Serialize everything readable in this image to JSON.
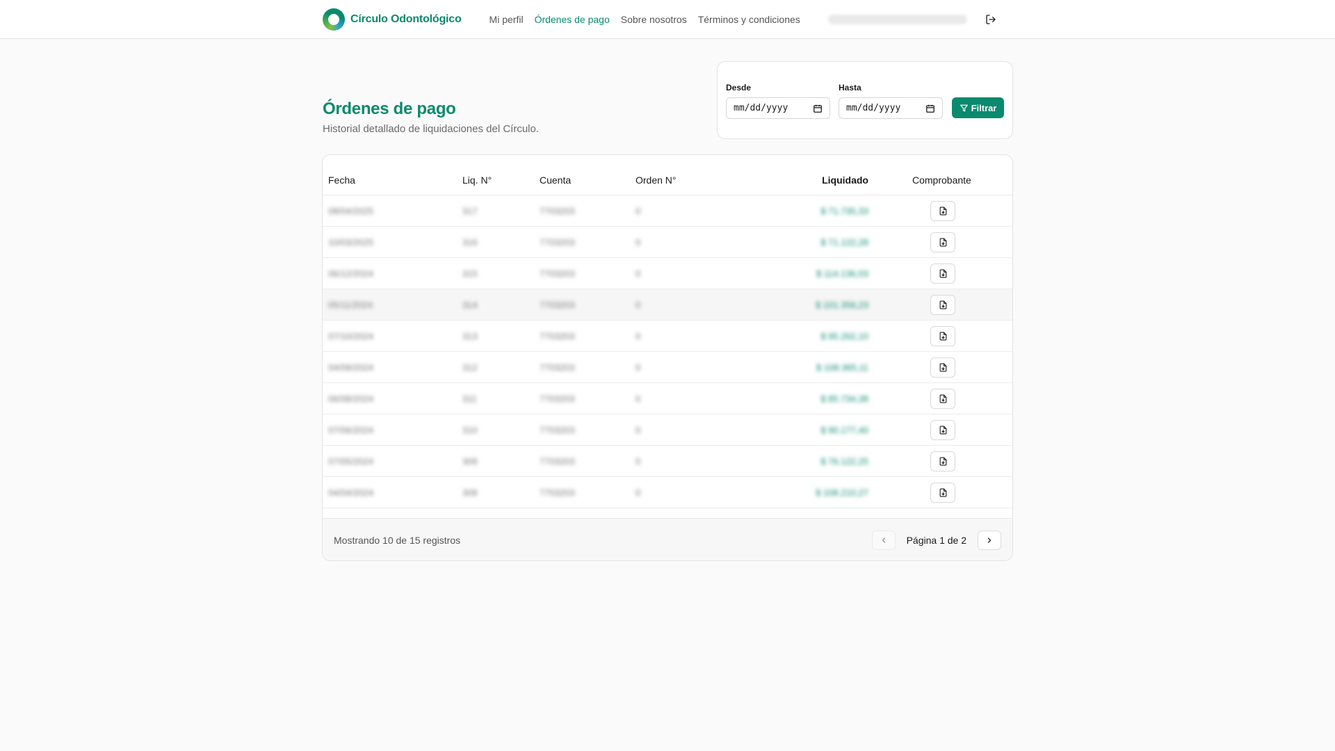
{
  "header": {
    "brand": "Círculo Odontológico",
    "nav": [
      {
        "label": "Mi perfil",
        "active": false
      },
      {
        "label": "Órdenes de pago",
        "active": true
      },
      {
        "label": "Sobre nosotros",
        "active": false
      },
      {
        "label": "Términos y condiciones",
        "active": false
      }
    ],
    "user": "Prestador del Círculo Odontológico"
  },
  "page": {
    "title": "Órdenes de pago",
    "subtitle": "Historial detallado de liquidaciones del Círculo."
  },
  "filter": {
    "from_label": "Desde",
    "to_label": "Hasta",
    "from_value": "mm/dd/yyyy",
    "to_value": "mm/dd/yyyy",
    "button": "Filtrar"
  },
  "table": {
    "columns": [
      "Fecha",
      "Liq. N°",
      "Cuenta",
      "Orden N°",
      "Liquidado",
      "Comprobante"
    ],
    "rows": [
      {
        "fecha": "08/04/2025",
        "liq": "317",
        "cuenta": "7703203",
        "orden": "0",
        "liquidado": "$ 71.735,33"
      },
      {
        "fecha": "10/03/2025",
        "liq": "316",
        "cuenta": "7703203",
        "orden": "0",
        "liquidado": "$ 71.122,28"
      },
      {
        "fecha": "06/12/2024",
        "liq": "315",
        "cuenta": "7703203",
        "orden": "0",
        "liquidado": "$ 114.136,03"
      },
      {
        "fecha": "05/11/2024",
        "liq": "314",
        "cuenta": "7703203",
        "orden": "0",
        "liquidado": "$ 101.356,23"
      },
      {
        "fecha": "07/10/2024",
        "liq": "313",
        "cuenta": "7703203",
        "orden": "0",
        "liquidado": "$ 95.262,10"
      },
      {
        "fecha": "04/09/2024",
        "liq": "312",
        "cuenta": "7703203",
        "orden": "0",
        "liquidado": "$ 108.365,11"
      },
      {
        "fecha": "06/08/2024",
        "liq": "311",
        "cuenta": "7703203",
        "orden": "0",
        "liquidado": "$ 85.734,38"
      },
      {
        "fecha": "07/06/2024",
        "liq": "310",
        "cuenta": "7703203",
        "orden": "0",
        "liquidado": "$ 90.177,40"
      },
      {
        "fecha": "07/05/2024",
        "liq": "309",
        "cuenta": "7703203",
        "orden": "0",
        "liquidado": "$ 76.122,25"
      },
      {
        "fecha": "04/04/2024",
        "liq": "308",
        "cuenta": "7703203",
        "orden": "0",
        "liquidado": "$ 108.210,27"
      }
    ]
  },
  "footer": {
    "records": "Mostrando 10 de 15 registros",
    "page": "Página 1 de 2"
  },
  "colors": {
    "accent": "#0a8a6e",
    "background": "#fafafa"
  }
}
